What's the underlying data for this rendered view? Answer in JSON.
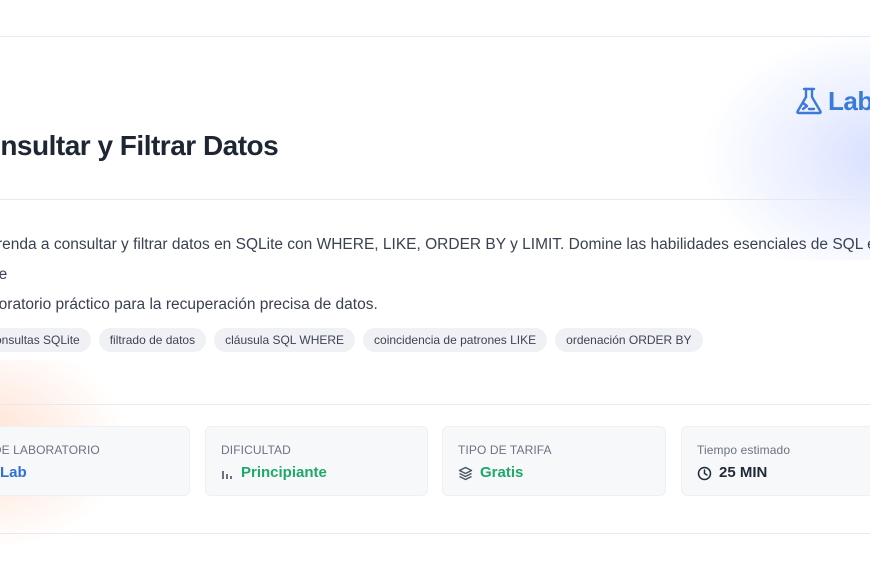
{
  "brand": {
    "logo_text": "LabEx",
    "logo_icon": "flask-icon",
    "accent_color": "#3b7ad9"
  },
  "header": {
    "title": "Consultar y Filtrar Datos"
  },
  "description": {
    "line1": "Aprenda a consultar y filtrar datos en SQLite con WHERE, LIKE, ORDER BY y LIMIT. Domine las habilidades esenciales de SQL en este",
    "line2": "laboratorio práctico para la recuperación precisa de datos."
  },
  "tags": [
    "consultas SQLite",
    "filtrado de datos",
    "cláusula SQL WHERE",
    "coincidencia de patrones LIKE",
    "ordenación ORDER BY"
  ],
  "info_cards": [
    {
      "label": "TIPO DE LABORATORIO",
      "value": "Lab",
      "icon": "lab-icon",
      "color": "#2f6fd8"
    },
    {
      "label": "DIFICULTAD",
      "value": "Principiante",
      "icon": "bar-chart-icon",
      "color": "#1fa86a"
    },
    {
      "label": "TIPO DE TARIFA",
      "value": "Gratis",
      "icon": "layers-icon",
      "color": "#1fa86a"
    },
    {
      "label": "Tiempo estimado",
      "value": "25 MIN",
      "icon": "clock-icon",
      "color": "#1f2937"
    }
  ]
}
